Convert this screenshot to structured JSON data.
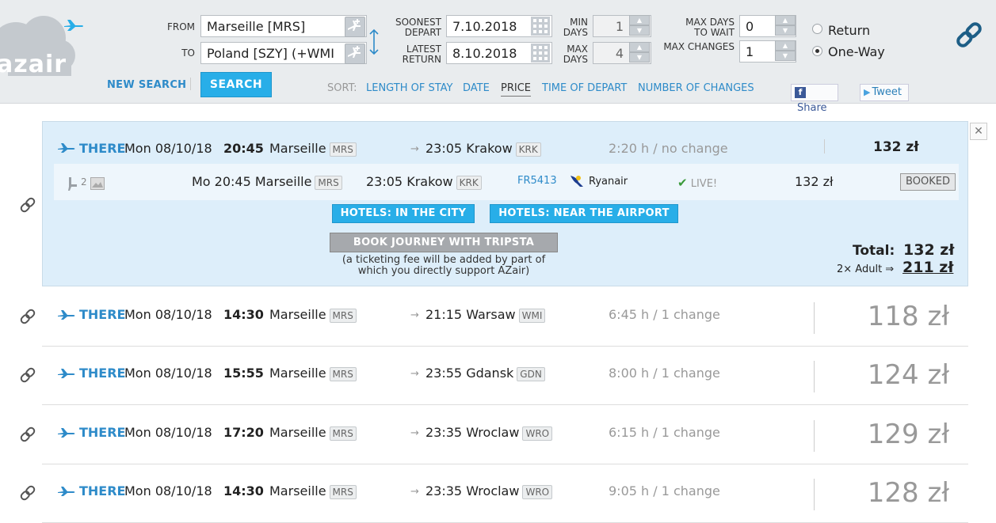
{
  "logo": {
    "text": "azair"
  },
  "search": {
    "from_label": "FROM",
    "to_label": "TO",
    "from_value": "Marseille [MRS]",
    "to_value": "Poland [SZY] (+WMI",
    "soonest_label_1": "SOONEST",
    "soonest_label_2": "DEPART",
    "soonest_value": "7.10.2018",
    "latest_label_1": "LATEST",
    "latest_label_2": "RETURN",
    "latest_value": "8.10.2018",
    "min_label_1": "MIN",
    "min_label_2": "DAYS",
    "min_value": "1",
    "max_label_1": "MAX",
    "max_label_2": "DAYS",
    "max_value": "4",
    "wait_label_1": "MAX DAYS",
    "wait_label_2": "TO WAIT",
    "wait_value": "0",
    "changes_label": "MAX CHANGES",
    "changes_value": "1",
    "return_label": "Return",
    "oneway_label": "One-Way",
    "new_search": "NEW SEARCH",
    "search_button": "SEARCH"
  },
  "sort": {
    "label": "SORT:",
    "options": [
      "LENGTH OF STAY",
      "DATE",
      "PRICE",
      "TIME OF DEPART",
      "NUMBER OF CHANGES"
    ]
  },
  "social": {
    "share": "Share",
    "tweet": "Tweet"
  },
  "expanded": {
    "direction": "THERE",
    "date": "Mon 08/10/18",
    "dep_time": "20:45",
    "dep_city": "Marseille",
    "dep_code": "MRS",
    "arr_time": "23:05",
    "arr_city": "Krakow",
    "arr_code": "KRK",
    "duration": "2:20 h / no change",
    "price": "132 zł",
    "leg": {
      "seats": "2",
      "day_dep": "Mo 20:45 Marseille",
      "dep_code": "MRS",
      "arr": "23:05 Krakow",
      "arr_code": "KRK",
      "flight": "FR5413",
      "airline": "Ryanair",
      "live": "LIVE!",
      "price": "132 zł",
      "booked": "BOOKED"
    },
    "hotels_city": "HOTELS: IN THE CITY",
    "hotels_airport": "HOTELS: NEAR THE AIRPORT",
    "tripsta": "BOOK JOURNEY WITH TRIPSTA",
    "fee_note_1": "(a ticketing fee will be added by part of",
    "fee_note_2": "which you directly support AZair)",
    "total_label": "Total:",
    "total_value": "132 zł",
    "adult_label": "2× Adult ⇒",
    "adult_value": "211 zł"
  },
  "results": [
    {
      "direction": "THERE",
      "date": "Mon 08/10/18",
      "dep_time": "14:30",
      "dep_city": "Marseille",
      "dep_code": "MRS",
      "arr": "21:15 Warsaw",
      "arr_code": "WMI",
      "duration": "6:45 h / 1 change",
      "price": "118 zł"
    },
    {
      "direction": "THERE",
      "date": "Mon 08/10/18",
      "dep_time": "15:55",
      "dep_city": "Marseille",
      "dep_code": "MRS",
      "arr": "23:55 Gdansk",
      "arr_code": "GDN",
      "duration": "8:00 h / 1 change",
      "price": "124 zł"
    },
    {
      "direction": "THERE",
      "date": "Mon 08/10/18",
      "dep_time": "17:20",
      "dep_city": "Marseille",
      "dep_code": "MRS",
      "arr": "23:35 Wroclaw",
      "arr_code": "WRO",
      "duration": "6:15 h / 1 change",
      "price": "129 zł"
    },
    {
      "direction": "THERE",
      "date": "Mon 08/10/18",
      "dep_time": "14:30",
      "dep_city": "Marseille",
      "dep_code": "MRS",
      "arr": "23:35 Wroclaw",
      "arr_code": "WRO",
      "duration": "9:05 h / 1 change",
      "price": "128 zł"
    }
  ]
}
